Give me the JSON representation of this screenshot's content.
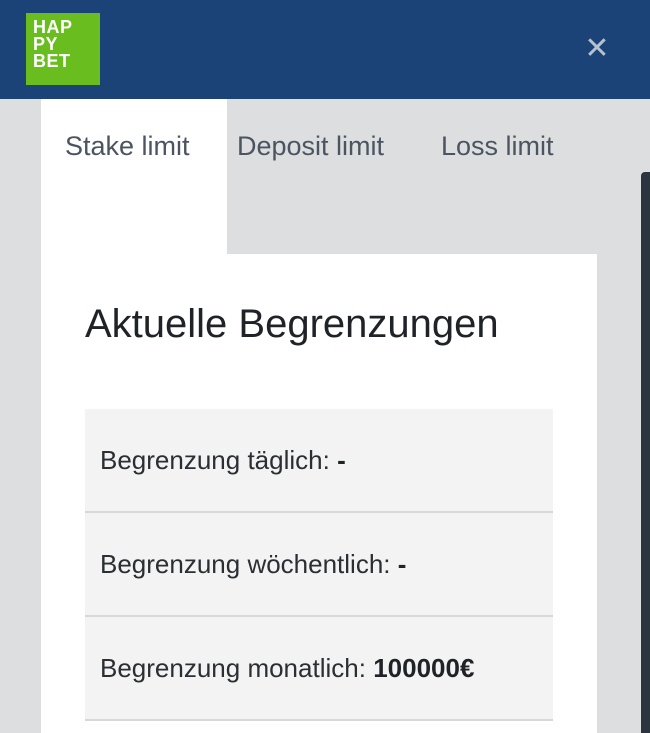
{
  "header": {
    "logo_lines": [
      "HAP",
      "PY",
      "BET"
    ],
    "close_glyph": "✕"
  },
  "tabs": [
    {
      "label": "Stake limit",
      "active": true
    },
    {
      "label": "Deposit limit",
      "active": false
    },
    {
      "label": "Loss limit",
      "active": false
    }
  ],
  "panel": {
    "title": "Aktuelle Begrenzungen",
    "limits": [
      {
        "label": "Begrenzung täglich:",
        "value": "-"
      },
      {
        "label": "Begrenzung wöchentlich:",
        "value": "-"
      },
      {
        "label": "Begrenzung monatlich:",
        "value": "100000€"
      }
    ]
  },
  "colors": {
    "header_bg": "#1c4378",
    "logo_bg": "#69bd1f",
    "page_bg": "#dcdedf",
    "row_bg": "#f3f3f3"
  }
}
